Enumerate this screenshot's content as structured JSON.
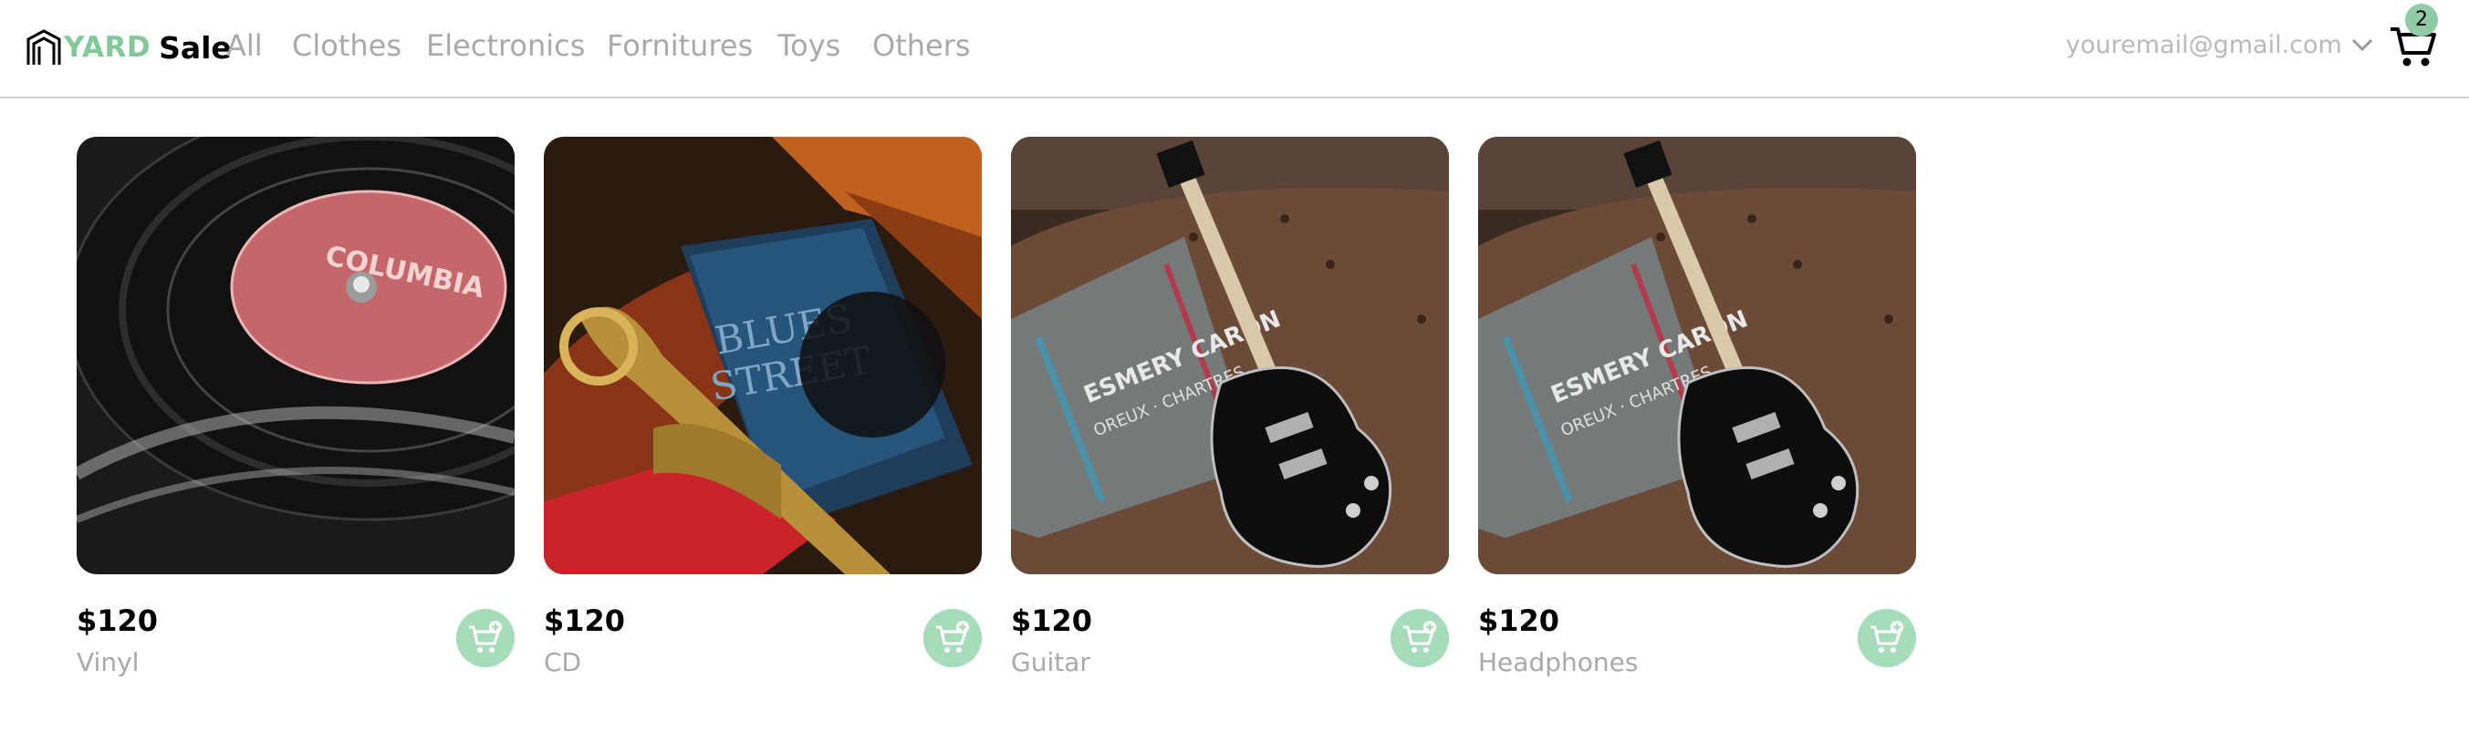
{
  "brand": {
    "part1": "YARD",
    "part2": "Sale"
  },
  "nav": [
    "All",
    "Clothes",
    "Electronics",
    "Fornitures",
    "Toys",
    "Others"
  ],
  "user": {
    "email": "youremail@gmail.com"
  },
  "cart": {
    "count": "2"
  },
  "colors": {
    "brand_green": "#82c99a",
    "button_green": "#a6dcba",
    "badge_green": "#8fcca6"
  },
  "products": [
    {
      "price": "$120",
      "name": "Vinyl",
      "image": "vinyl-record"
    },
    {
      "price": "$120",
      "name": "CD",
      "image": "trumpet-and-cd"
    },
    {
      "price": "$120",
      "name": "Guitar",
      "image": "electric-guitar"
    },
    {
      "price": "$120",
      "name": "Headphones",
      "image": "electric-guitar"
    }
  ]
}
